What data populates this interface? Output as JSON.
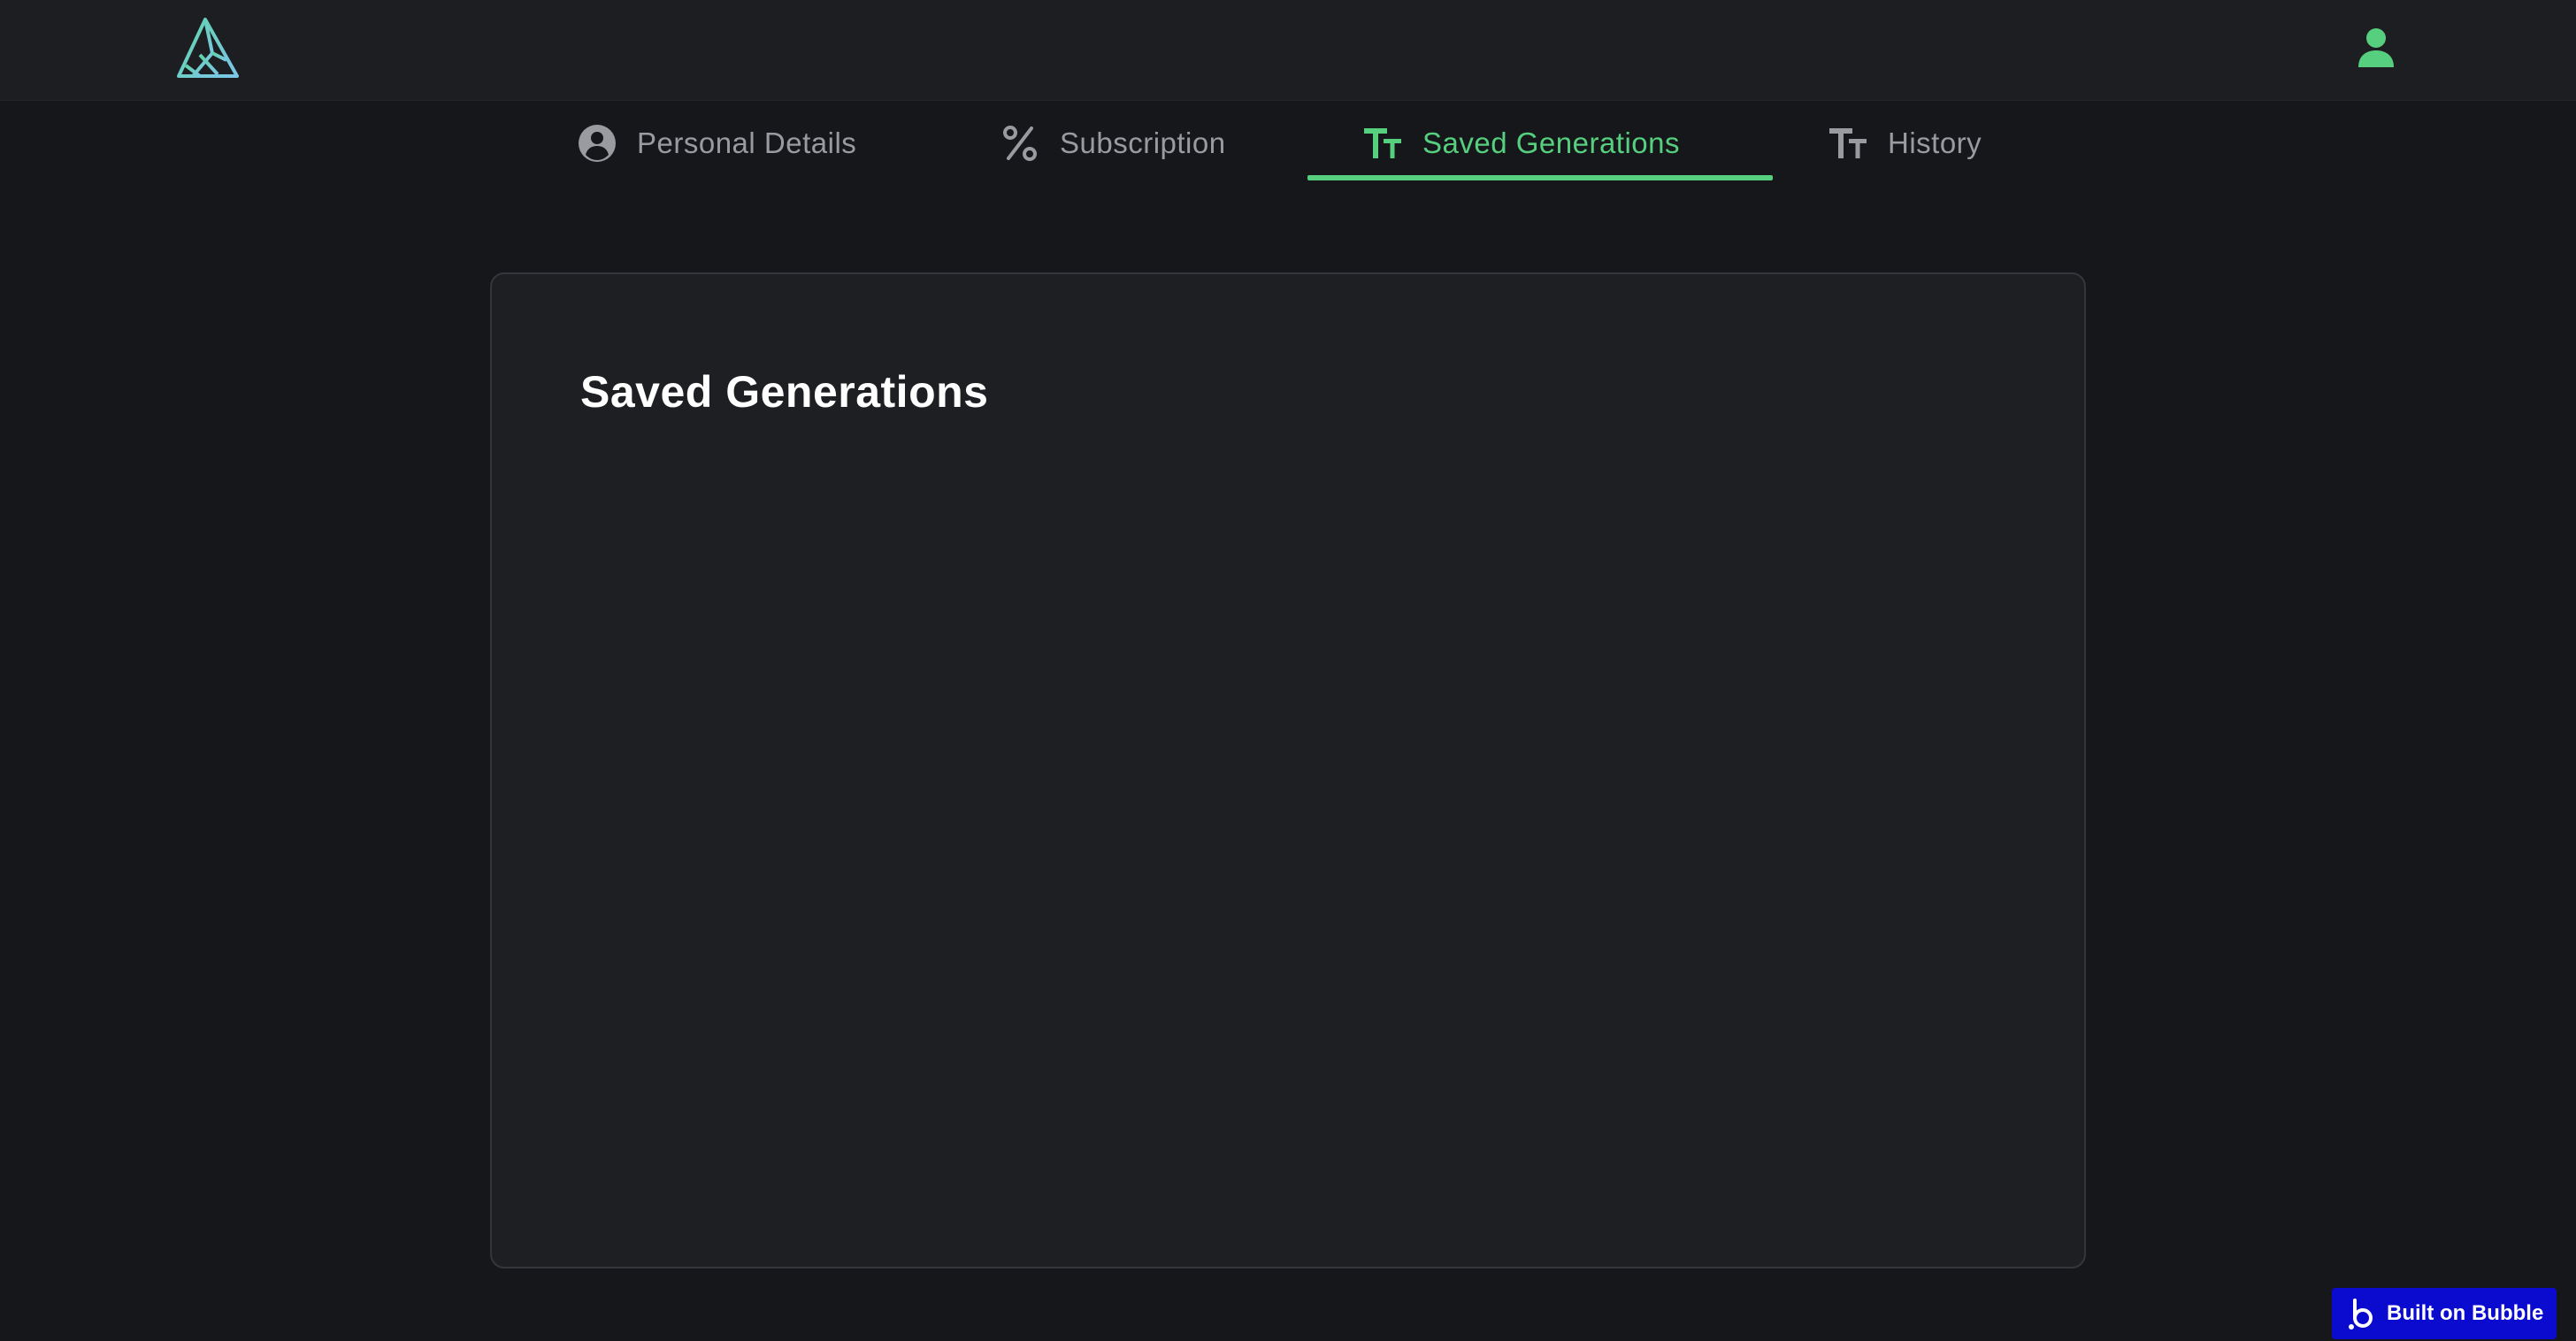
{
  "header": {
    "logo_icon": "triangle-logo-icon",
    "user_icon": "user-icon",
    "accent_color": "#56cf7e"
  },
  "tabs": [
    {
      "label": "Personal Details",
      "icon": "user-circle-icon",
      "active": false
    },
    {
      "label": "Subscription",
      "icon": "percent-icon",
      "active": false
    },
    {
      "label": "Saved Generations",
      "icon": "text-size-icon",
      "active": true
    },
    {
      "label": "History",
      "icon": "text-size-icon",
      "active": false
    }
  ],
  "main": {
    "title": "Saved Generations"
  },
  "footer": {
    "badge_label": "Built on Bubble",
    "badge_icon": "bubble-b-icon",
    "badge_color": "#0b0bcf"
  }
}
